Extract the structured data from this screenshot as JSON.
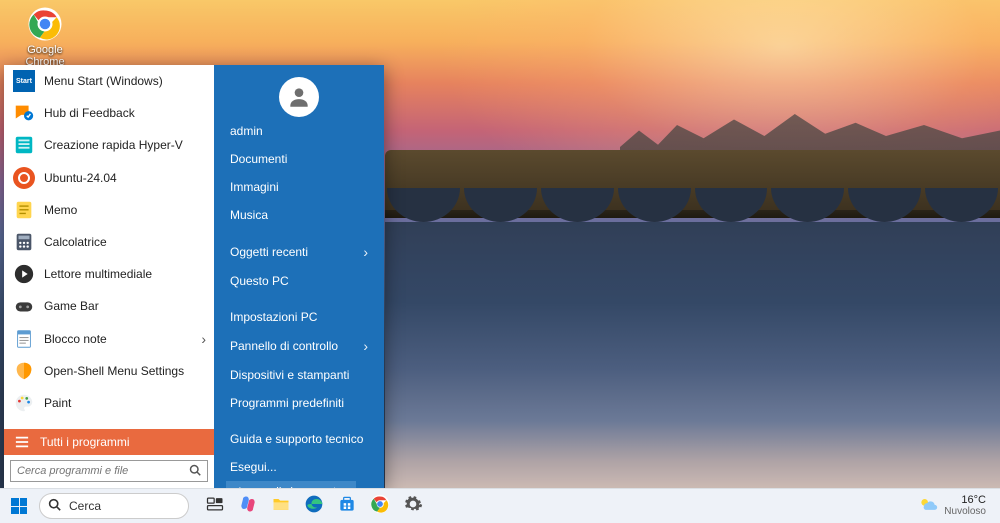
{
  "desktop_icons": [
    {
      "label": "Google Chrome"
    }
  ],
  "start_menu": {
    "left_apps": [
      {
        "label": "Menu Start (Windows)",
        "icon": "start-tile-icon",
        "chevron": false
      },
      {
        "label": "Hub di Feedback",
        "icon": "feedback-icon",
        "chevron": false
      },
      {
        "label": "Creazione rapida Hyper-V",
        "icon": "hyperv-icon",
        "chevron": false
      },
      {
        "label": "Ubuntu-24.04",
        "icon": "ubuntu-icon",
        "chevron": false
      },
      {
        "label": "Memo",
        "icon": "memo-icon",
        "chevron": false
      },
      {
        "label": "Calcolatrice",
        "icon": "calculator-icon",
        "chevron": false
      },
      {
        "label": "Lettore multimediale",
        "icon": "media-player-icon",
        "chevron": false
      },
      {
        "label": "Game Bar",
        "icon": "gamebar-icon",
        "chevron": false
      },
      {
        "label": "Blocco note",
        "icon": "notepad-icon",
        "chevron": true
      },
      {
        "label": "Open-Shell Menu Settings",
        "icon": "openshell-icon",
        "chevron": false
      },
      {
        "label": "Paint",
        "icon": "paint-icon",
        "chevron": false
      }
    ],
    "all_programs_label": "Tutti i programmi",
    "search_placeholder": "Cerca programmi e file",
    "user_name": "admin",
    "right_links_group1": [
      {
        "label": "Documenti",
        "chevron": false
      },
      {
        "label": "Immagini",
        "chevron": false
      },
      {
        "label": "Musica",
        "chevron": false
      }
    ],
    "right_links_group2": [
      {
        "label": "Oggetti recenti",
        "chevron": true
      },
      {
        "label": "Questo PC",
        "chevron": false
      }
    ],
    "right_links_group3": [
      {
        "label": "Impostazioni PC",
        "chevron": false
      },
      {
        "label": "Pannello di controllo",
        "chevron": true
      },
      {
        "label": "Dispositivi e stampanti",
        "chevron": false
      },
      {
        "label": "Programmi predefiniti",
        "chevron": false
      }
    ],
    "right_links_group4": [
      {
        "label": "Guida e supporto tecnico",
        "chevron": false
      },
      {
        "label": "Esegui...",
        "chevron": false
      }
    ],
    "shutdown_label": "Arresta il sistema"
  },
  "taskbar": {
    "search_label": "Cerca",
    "pinned": [
      {
        "name": "task-view-icon"
      },
      {
        "name": "copilot-icon"
      },
      {
        "name": "file-explorer-icon"
      },
      {
        "name": "edge-icon"
      },
      {
        "name": "microsoft-store-icon"
      },
      {
        "name": "chrome-icon"
      },
      {
        "name": "settings-icon"
      }
    ],
    "weather": {
      "temp": "16°C",
      "condition": "Nuvoloso"
    }
  }
}
